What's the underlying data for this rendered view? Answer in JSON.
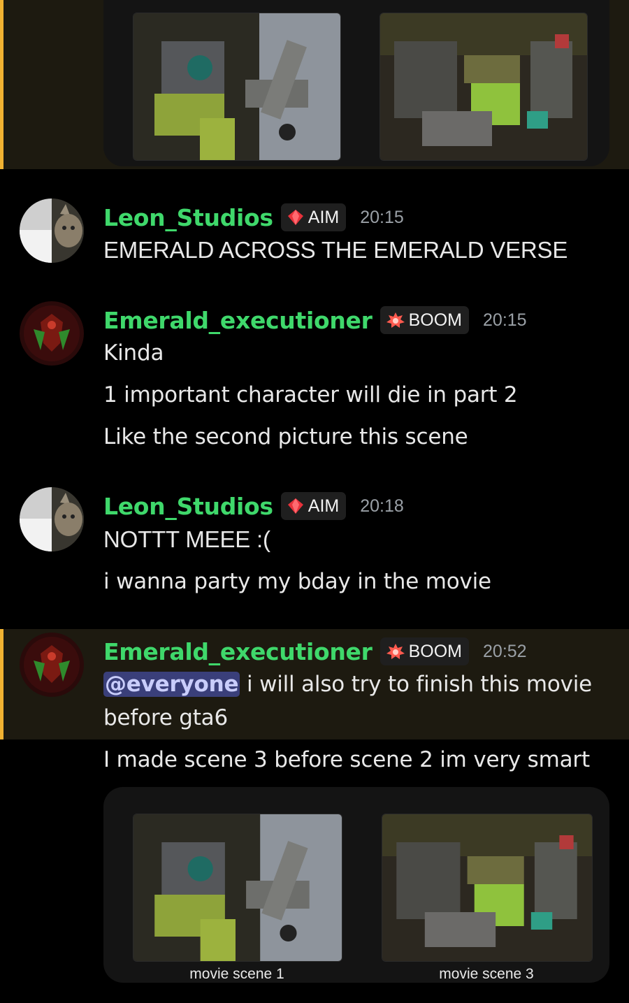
{
  "colors": {
    "background": "#000000",
    "mention_highlight_bg": "#1d1a10",
    "mention_bar": "#f0b232",
    "username": "#3fd86b",
    "timestamp": "#9aa0a6",
    "mention_pill": "#3a3f7a"
  },
  "top_attachments": [
    {
      "icon": "image-thumbnail",
      "alt": ""
    },
    {
      "icon": "image-thumbnail",
      "alt": ""
    }
  ],
  "messages": [
    {
      "username": "Leon_Studios",
      "tag_icon": "red-gem-icon",
      "tag": "AIM",
      "time": "20:15",
      "lines": [
        "EMERALD ACROSS THE EMERALD VERSE"
      ]
    },
    {
      "username": "Emerald_executioner",
      "tag_icon": "explosion-icon",
      "tag": "BOOM",
      "time": "20:15",
      "lines": [
        "Kinda",
        "1 important character will die in part 2",
        "Like the second picture this scene"
      ]
    },
    {
      "username": "Leon_Studios",
      "tag_icon": "red-gem-icon",
      "tag": "AIM",
      "time": "20:18",
      "lines": [
        "NOTTT MEEE :(",
        "i wanna party my bday in the movie"
      ]
    },
    {
      "username": "Emerald_executioner",
      "tag_icon": "explosion-icon",
      "tag": "BOOM",
      "time": "20:52",
      "mention": "@everyone",
      "lines": [
        " i will also try to finish this movie",
        "before gta6",
        "I made scene 3 before scene 2 im very smart"
      ]
    }
  ],
  "bottom_attachments": [
    {
      "caption": "movie scene 1"
    },
    {
      "caption": "movie scene 3"
    }
  ]
}
